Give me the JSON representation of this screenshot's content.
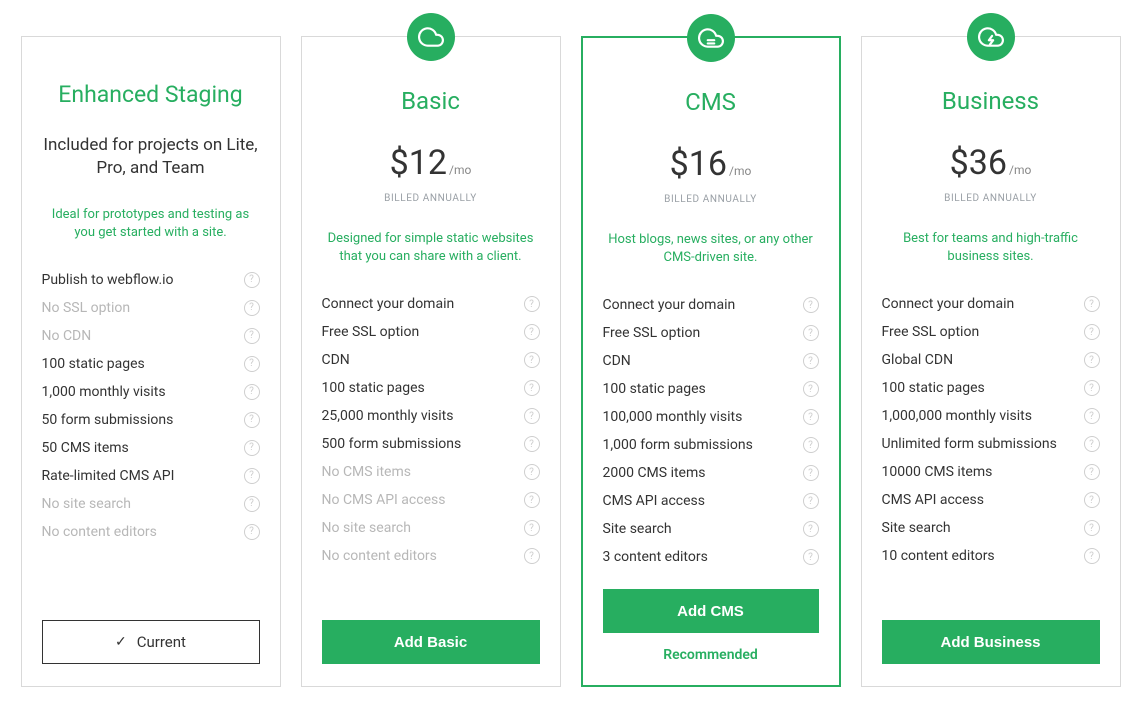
{
  "plans": [
    {
      "id": "staging",
      "title": "Enhanced Staging",
      "subtitle": "Included for projects on Lite, Pro, and Team",
      "description": "Ideal for prototypes and testing as you get started with a site.",
      "cta_label": "Current",
      "cta_type": "current",
      "features": [
        {
          "label": "Publish to webflow.io",
          "muted": false
        },
        {
          "label": "No SSL option",
          "muted": true
        },
        {
          "label": "No CDN",
          "muted": true
        },
        {
          "label": "100 static pages",
          "muted": false
        },
        {
          "label": "1,000 monthly visits",
          "muted": false
        },
        {
          "label": "50 form submissions",
          "muted": false
        },
        {
          "label": "50 CMS items",
          "muted": false
        },
        {
          "label": "Rate-limited CMS API",
          "muted": false
        },
        {
          "label": "No site search",
          "muted": true
        },
        {
          "label": "No content editors",
          "muted": true
        }
      ]
    },
    {
      "id": "basic",
      "title": "Basic",
      "price": "$12",
      "per": "/mo",
      "billing": "BILLED ANNUALLY",
      "description": "Designed for simple static websites that you can share with a client.",
      "cta_label": "Add Basic",
      "cta_type": "add",
      "icon": "cloud",
      "features": [
        {
          "label": "Connect your domain",
          "muted": false
        },
        {
          "label": "Free SSL option",
          "muted": false
        },
        {
          "label": "CDN",
          "muted": false
        },
        {
          "label": "100 static pages",
          "muted": false
        },
        {
          "label": "25,000 monthly visits",
          "muted": false
        },
        {
          "label": "500 form submissions",
          "muted": false
        },
        {
          "label": "No CMS items",
          "muted": true
        },
        {
          "label": "No CMS API access",
          "muted": true
        },
        {
          "label": "No site search",
          "muted": true
        },
        {
          "label": "No content editors",
          "muted": true
        }
      ]
    },
    {
      "id": "cms",
      "title": "CMS",
      "price": "$16",
      "per": "/mo",
      "billing": "BILLED ANNUALLY",
      "description": "Host blogs, news sites, or any other CMS-driven site.",
      "cta_label": "Add CMS",
      "cta_type": "add",
      "highlighted": true,
      "recommended_label": "Recommended",
      "icon": "cloud-lines",
      "features": [
        {
          "label": "Connect your domain",
          "muted": false
        },
        {
          "label": "Free SSL option",
          "muted": false
        },
        {
          "label": "CDN",
          "muted": false
        },
        {
          "label": "100 static pages",
          "muted": false
        },
        {
          "label": "100,000 monthly visits",
          "muted": false
        },
        {
          "label": "1,000 form submissions",
          "muted": false
        },
        {
          "label": "2000 CMS items",
          "muted": false
        },
        {
          "label": "CMS API access",
          "muted": false
        },
        {
          "label": "Site search",
          "muted": false
        },
        {
          "label": "3 content editors",
          "muted": false
        }
      ]
    },
    {
      "id": "business",
      "title": "Business",
      "price": "$36",
      "per": "/mo",
      "billing": "BILLED ANNUALLY",
      "description": "Best for teams and high-traffic business sites.",
      "cta_label": "Add Business",
      "cta_type": "add",
      "icon": "cloud-bolt",
      "features": [
        {
          "label": "Connect your domain",
          "muted": false
        },
        {
          "label": "Free SSL option",
          "muted": false
        },
        {
          "label": "Global CDN",
          "muted": false
        },
        {
          "label": "100 static pages",
          "muted": false
        },
        {
          "label": "1,000,000 monthly visits",
          "muted": false
        },
        {
          "label": "Unlimited form submissions",
          "muted": false
        },
        {
          "label": "10000 CMS items",
          "muted": false
        },
        {
          "label": "CMS API access",
          "muted": false
        },
        {
          "label": "Site search",
          "muted": false
        },
        {
          "label": "10 content editors",
          "muted": false
        }
      ]
    }
  ]
}
